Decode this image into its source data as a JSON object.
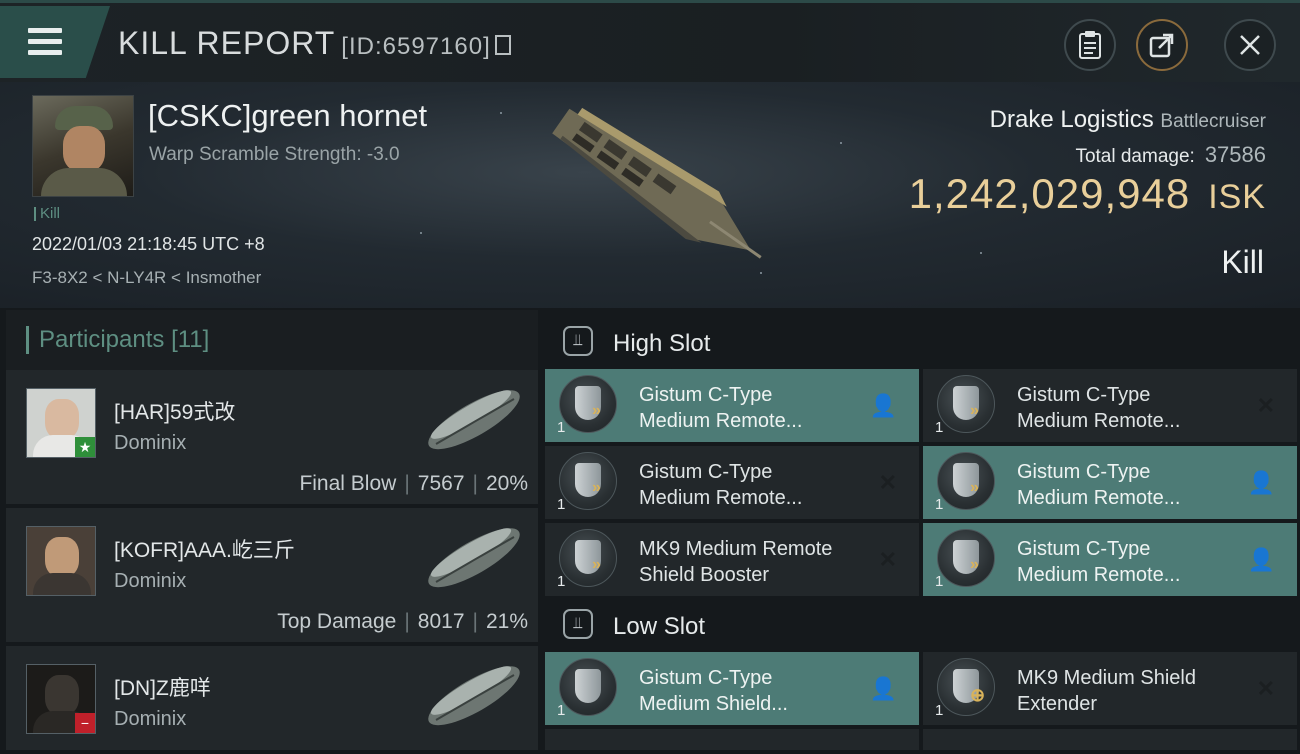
{
  "header": {
    "title": "KILL REPORT",
    "report_id": "[ID:6597160]"
  },
  "victim": {
    "pilot_name": "[CSKC]green hornet",
    "warp_scramble": "Warp Scramble Strength: -3.0",
    "result_tag": "Kill",
    "datetime": "2022/01/03 21:18:45 UTC +8",
    "location": "F3-8X2 < N-LY4R < Insmother",
    "ship_name": "Drake Logistics",
    "ship_class": "Battlecruiser",
    "total_damage_label": "Total damage:",
    "total_damage": "37586",
    "isk_value": "1,242,029,948",
    "isk_unit": "ISK",
    "result_big": "Kill"
  },
  "participants": {
    "label": "Participants",
    "count": "[11]",
    "items": [
      {
        "name": "[HAR]59式改",
        "ship": "Dominix",
        "role": "Final Blow",
        "damage": "7567",
        "percent": "20%",
        "badge": "★",
        "badge_color": "#2f8f3a"
      },
      {
        "name": "[KOFR]AAA.屹三斤",
        "ship": "Dominix",
        "role": "Top Damage",
        "damage": "8017",
        "percent": "21%",
        "badge": "",
        "badge_color": ""
      },
      {
        "name": "[DN]Z鹿咩",
        "ship": "Dominix",
        "role": "",
        "damage": "",
        "percent": "",
        "badge": "−",
        "badge_color": "#c0202a"
      }
    ]
  },
  "slots": {
    "high": {
      "label": "High Slot",
      "modules": [
        {
          "name": "Gistum C-Type\nMedium Remote...",
          "qty": "1",
          "status": "person-icon",
          "active": true
        },
        {
          "name": "Gistum C-Type\nMedium Remote...",
          "qty": "1",
          "status": "x-icon",
          "active": false
        },
        {
          "name": "Gistum C-Type\nMedium Remote...",
          "qty": "1",
          "status": "x-icon",
          "active": false
        },
        {
          "name": "Gistum C-Type\nMedium Remote...",
          "qty": "1",
          "status": "person-icon",
          "active": true
        },
        {
          "name": "MK9 Medium Remote\nShield Booster",
          "qty": "1",
          "status": "x-icon",
          "active": false
        },
        {
          "name": "Gistum C-Type\nMedium Remote...",
          "qty": "1",
          "status": "person-icon",
          "active": true
        }
      ]
    },
    "low": {
      "label": "Low Slot",
      "modules": [
        {
          "name": "Gistum C-Type\nMedium Shield...",
          "qty": "1",
          "status": "person-icon",
          "active": true
        },
        {
          "name": "MK9 Medium Shield\nExtender",
          "qty": "1",
          "status": "x-icon",
          "active": false
        }
      ]
    }
  },
  "colors": {
    "accent": "#4d7b76",
    "isk": "#e9cf9a",
    "participants_label": "#5e8f82"
  }
}
